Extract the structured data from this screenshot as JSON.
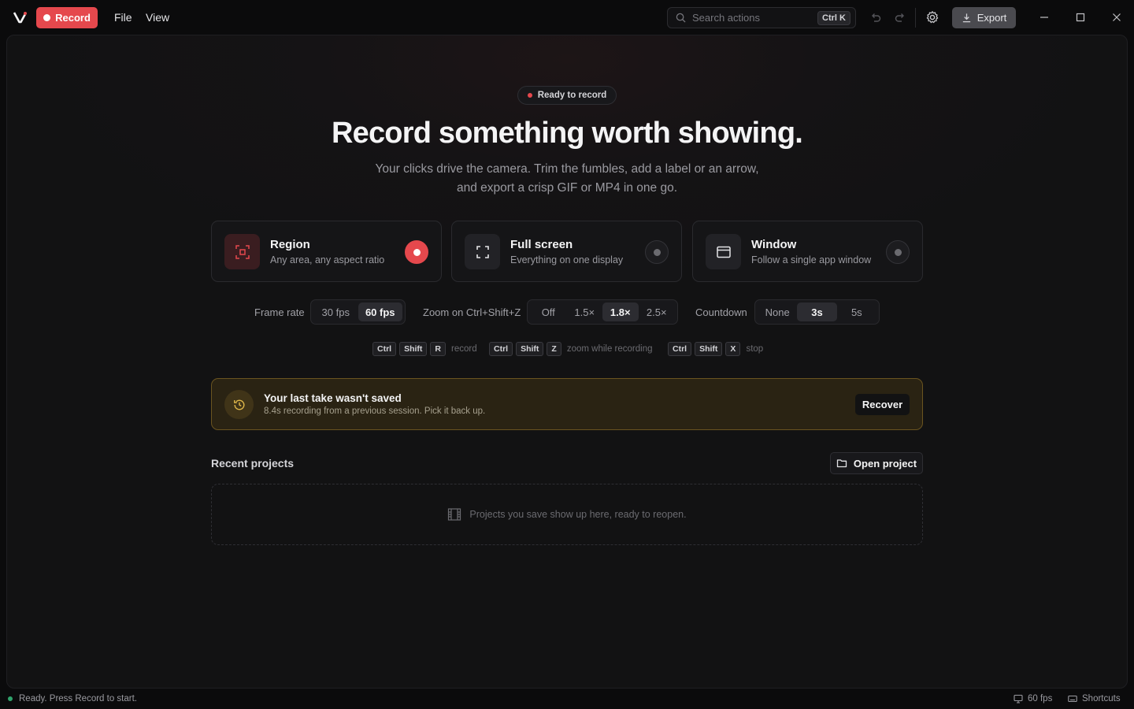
{
  "titlebar": {
    "record_label": "Record",
    "menus": [
      "File",
      "View"
    ],
    "search_placeholder": "Search actions",
    "search_shortcut": "Ctrl K",
    "export_label": "Export"
  },
  "hero": {
    "status_pill": "Ready to record",
    "headline": "Record something worth showing.",
    "subline_1": "Your clicks drive the camera. Trim the fumbles, add a label or an arrow,",
    "subline_2": "and export a crisp GIF or MP4 in one go."
  },
  "modes": [
    {
      "title": "Region",
      "desc": "Any area, any aspect ratio",
      "selected": true
    },
    {
      "title": "Full screen",
      "desc": "Everything on one display",
      "selected": false
    },
    {
      "title": "Window",
      "desc": "Follow a single app window",
      "selected": false
    }
  ],
  "options": {
    "frame_rate": {
      "label": "Frame rate",
      "choices": [
        "30 fps",
        "60 fps"
      ],
      "selected": "60 fps"
    },
    "zoom": {
      "label": "Zoom on Ctrl+Shift+Z",
      "choices": [
        "Off",
        "1.5×",
        "1.8×",
        "2.5×"
      ],
      "selected": "1.8×"
    },
    "countdown": {
      "label": "Countdown",
      "choices": [
        "None",
        "3s",
        "5s"
      ],
      "selected": "3s"
    }
  },
  "shortcuts": [
    {
      "keys": [
        "Ctrl",
        "Shift",
        "R"
      ],
      "action": "record"
    },
    {
      "keys": [
        "Ctrl",
        "Shift",
        "Z"
      ],
      "action": "zoom while recording"
    },
    {
      "keys": [
        "Ctrl",
        "Shift",
        "X"
      ],
      "action": "stop"
    }
  ],
  "banner": {
    "title": "Your last take wasn't saved",
    "desc": "8.4s recording from a previous session. Pick it back up.",
    "action": "Recover"
  },
  "recent": {
    "title": "Recent projects",
    "open_label": "Open project",
    "empty_text": "Projects you save show up here, ready to reopen."
  },
  "statusbar": {
    "message": "Ready. Press Record to start.",
    "fps": "60 fps",
    "shortcuts": "Shortcuts"
  },
  "colors": {
    "accent": "#e5484d",
    "warning_border": "#6a5420",
    "status_ok": "#30a46c"
  }
}
